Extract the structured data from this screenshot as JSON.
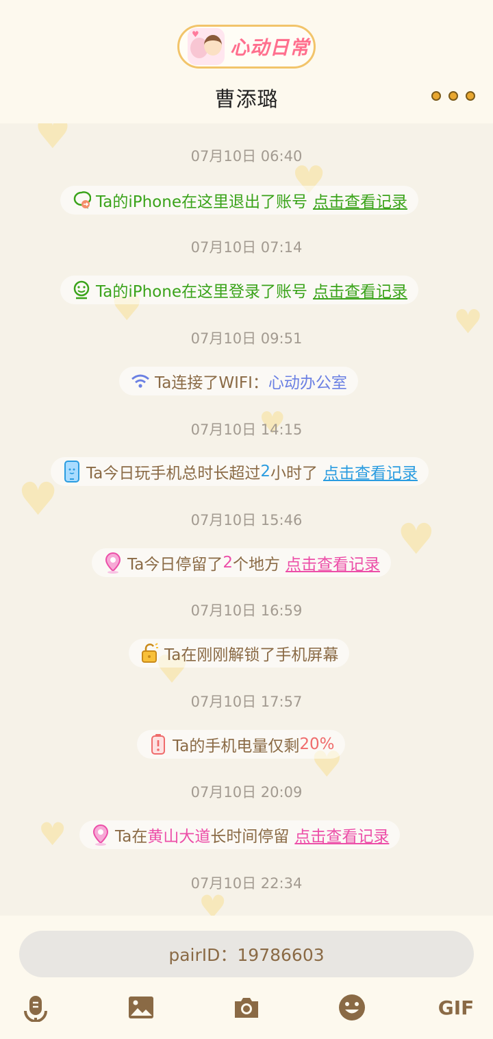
{
  "app": {
    "brand": "心动日常",
    "contact_name": "曹添璐"
  },
  "feed": [
    {
      "time": "07月10日 06:40",
      "icon": "chat-logout-icon",
      "parts": [
        {
          "text": "Ta的iPhone在这里退出了账号",
          "color": "green"
        }
      ],
      "link": "点击查看记录",
      "link_color": "green"
    },
    {
      "time": "07月10日 07:14",
      "icon": "smile-face-icon",
      "parts": [
        {
          "text": "Ta的iPhone在这里登录了账号",
          "color": "green"
        }
      ],
      "link": "点击查看记录",
      "link_color": "green"
    },
    {
      "time": "07月10日 09:51",
      "icon": "wifi-icon",
      "parts": [
        {
          "text": "Ta连接了WIFI：",
          "color": "brown"
        },
        {
          "text": "心动办公室",
          "color": "violet"
        }
      ],
      "link": "",
      "link_color": ""
    },
    {
      "time": "07月10日 14:15",
      "icon": "phone-icon",
      "parts": [
        {
          "text": "Ta今日玩手机总时长超过",
          "color": "brown"
        },
        {
          "text": "2",
          "color": "blue"
        },
        {
          "text": "小时了",
          "color": "brown"
        }
      ],
      "link": "点击查看记录",
      "link_color": "blue"
    },
    {
      "time": "07月10日 15:46",
      "icon": "location-pin-icon",
      "parts": [
        {
          "text": "Ta今日停留了",
          "color": "brown"
        },
        {
          "text": "2",
          "color": "pink"
        },
        {
          "text": "个地方",
          "color": "brown"
        }
      ],
      "link": "点击查看记录",
      "link_color": "pink"
    },
    {
      "time": "07月10日 16:59",
      "icon": "unlock-icon",
      "parts": [
        {
          "text": "Ta在刚刚解锁了手机屏幕",
          "color": "brown"
        }
      ],
      "link": "",
      "link_color": ""
    },
    {
      "time": "07月10日 17:57",
      "icon": "battery-low-icon",
      "parts": [
        {
          "text": "Ta的手机电量仅剩",
          "color": "brown"
        },
        {
          "text": "20%",
          "color": "red"
        }
      ],
      "link": "",
      "link_color": ""
    },
    {
      "time": "07月10日 20:09",
      "icon": "location-pin-icon",
      "parts": [
        {
          "text": "Ta在",
          "color": "brown"
        },
        {
          "text": "黄山大道",
          "color": "pink"
        },
        {
          "text": "长时间停留",
          "color": "brown"
        }
      ],
      "link": "点击查看记录",
      "link_color": "pink"
    },
    {
      "time": "07月10日 22:34"
    }
  ],
  "bottom": {
    "pair_id": "pairID：19786603",
    "gif_label": "GIF"
  },
  "colors": {
    "green": "#3aa31a",
    "brown": "#8a6a45",
    "blue": "#2a9ce0",
    "violet": "#6b80e3",
    "pink": "#ec4ea8",
    "red": "#ef6b6b",
    "accent": "#f2c46a",
    "bg": "#f6f2e8"
  }
}
